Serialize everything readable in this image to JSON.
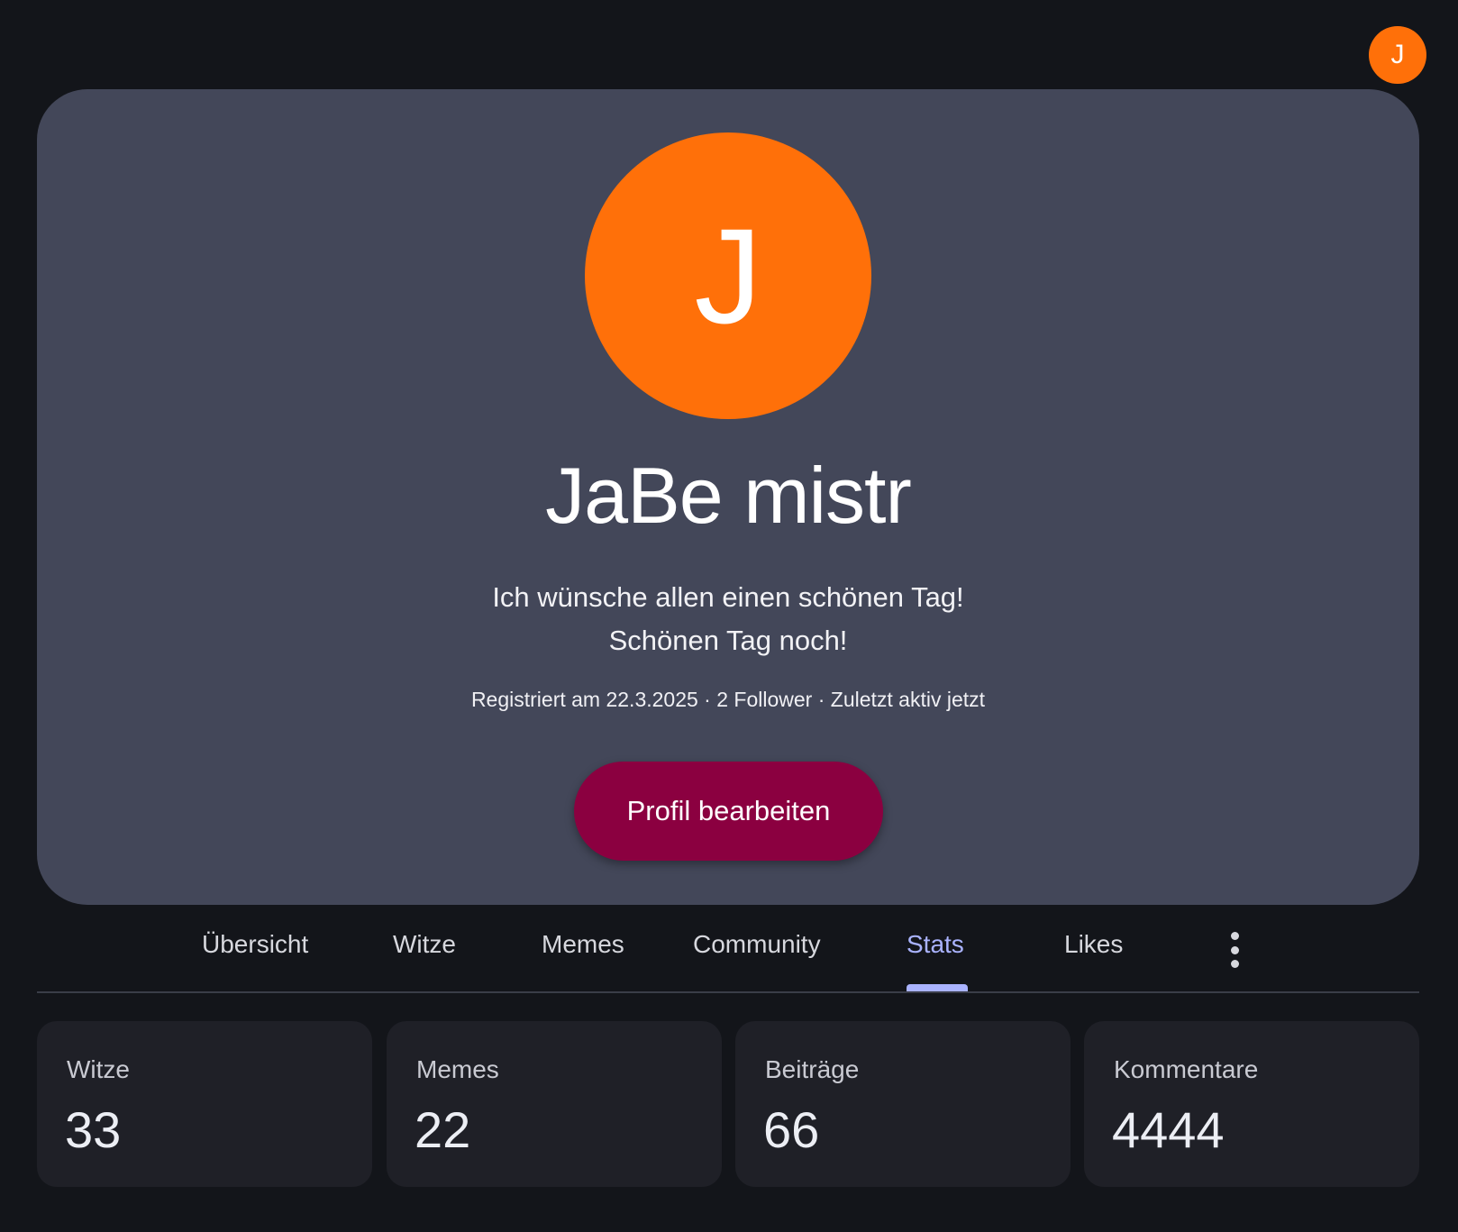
{
  "header": {
    "avatar_initial": "J",
    "avatar_color": "#ff7009"
  },
  "profile": {
    "avatar_initial": "J",
    "display_name": "JaBe mistr",
    "bio_lines": [
      "Ich wünsche allen einen schönen Tag!",
      "Schönen Tag noch!"
    ],
    "meta": "Registriert am 22.3.2025 · 2 Follower · Zuletzt aktiv jetzt",
    "edit_button_label": "Profil bearbeiten",
    "edit_button_color": "#8b0040"
  },
  "tabs": {
    "items": [
      {
        "label": "Übersicht"
      },
      {
        "label": "Witze"
      },
      {
        "label": "Memes"
      },
      {
        "label": "Community"
      },
      {
        "label": "Stats"
      },
      {
        "label": "Likes"
      }
    ],
    "active": "Stats",
    "active_color": "#aab3ff",
    "more_icon": "more-vertical-icon"
  },
  "stats": [
    {
      "label": "Witze",
      "value": "33"
    },
    {
      "label": "Memes",
      "value": "22"
    },
    {
      "label": "Beiträge",
      "value": "66"
    },
    {
      "label": "Kommentare",
      "value": "4444"
    }
  ]
}
